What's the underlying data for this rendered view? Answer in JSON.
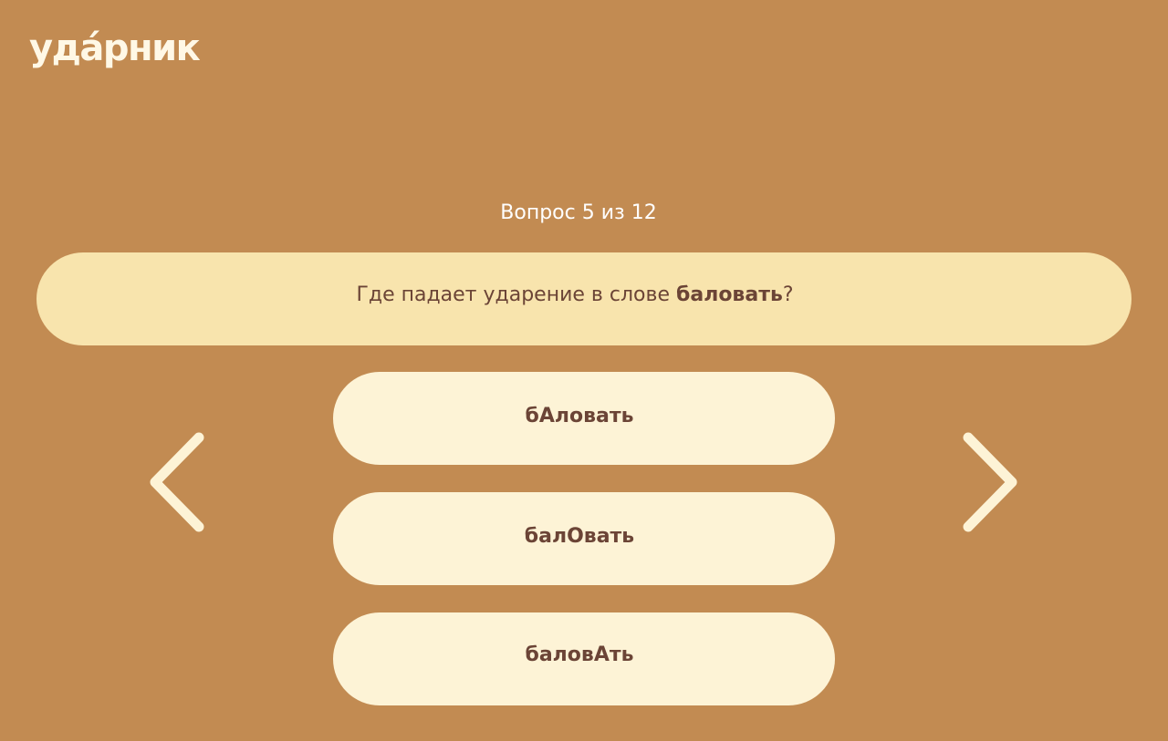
{
  "header": {
    "logo_text": "уда́рник"
  },
  "quiz": {
    "counter": "Вопрос 5 из 12",
    "question_prefix": "Где падает ударение в слове ",
    "question_word": "баловать",
    "question_suffix": "?",
    "answers": [
      {
        "label": "бАловать"
      },
      {
        "label": "балОвать"
      },
      {
        "label": "баловАть"
      }
    ]
  },
  "nav": {
    "prev_icon": "chevron-left-icon",
    "next_icon": "chevron-right-icon"
  },
  "colors": {
    "background": "#c28b52",
    "question_bg": "#f8e4ad",
    "answer_bg": "#fdf3d6",
    "text_dark": "#6b4436",
    "arrow": "#fdf3d6"
  }
}
